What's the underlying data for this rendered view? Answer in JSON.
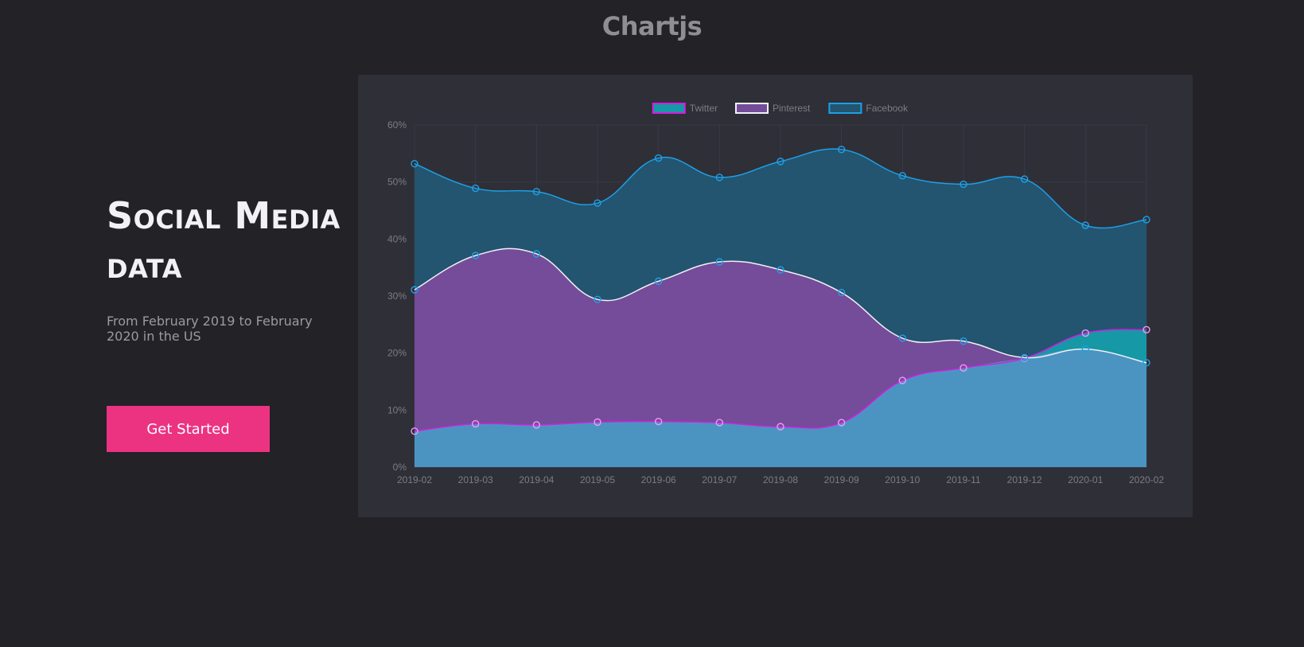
{
  "header": {
    "title": "Chartjs"
  },
  "hero": {
    "title_line1": "Social Media",
    "title_line2": "data",
    "subtitle": "From February 2019 to February 2020 in the US",
    "cta_label": "Get Started"
  },
  "colors": {
    "page_background": "#222227",
    "card_background": "#2f2f38",
    "cta": "#ec3382",
    "twitter_fill": "#1698a6",
    "twitter_line": "#d31ee0",
    "pinterest_fill": "#744c99",
    "pinterest_line": "#f0f0f5",
    "facebook_fill": "#235470",
    "facebook_line": "#1da0e6",
    "bottom_fill": "#4b94c2"
  },
  "chart_data": {
    "type": "area",
    "stacked": false,
    "categories": [
      "2019-02",
      "2019-03",
      "2019-04",
      "2019-05",
      "2019-06",
      "2019-07",
      "2019-08",
      "2019-09",
      "2019-10",
      "2019-11",
      "2019-12",
      "2020-01",
      "2020-02"
    ],
    "series": [
      {
        "name": "Twitter",
        "values": [
          6.3,
          7.6,
          7.4,
          7.9,
          8.0,
          7.8,
          7.1,
          7.8,
          15.2,
          17.4,
          19.1,
          23.5,
          24.1
        ]
      },
      {
        "name": "Pinterest",
        "values": [
          31.1,
          37.1,
          37.4,
          29.4,
          32.6,
          36.0,
          34.6,
          30.6,
          22.6,
          22.1,
          19.2,
          20.7,
          18.3
        ]
      },
      {
        "name": "Facebook",
        "values": [
          53.2,
          48.9,
          48.3,
          46.3,
          54.2,
          50.8,
          53.6,
          55.7,
          51.1,
          49.6,
          50.5,
          42.4,
          43.4
        ]
      }
    ],
    "y_ticks": [
      "0%",
      "10%",
      "20%",
      "30%",
      "40%",
      "50%",
      "60%"
    ],
    "ylim": [
      0,
      60
    ],
    "grid": true,
    "legend_position": "top-center",
    "title": "",
    "xlabel": "",
    "ylabel": ""
  }
}
